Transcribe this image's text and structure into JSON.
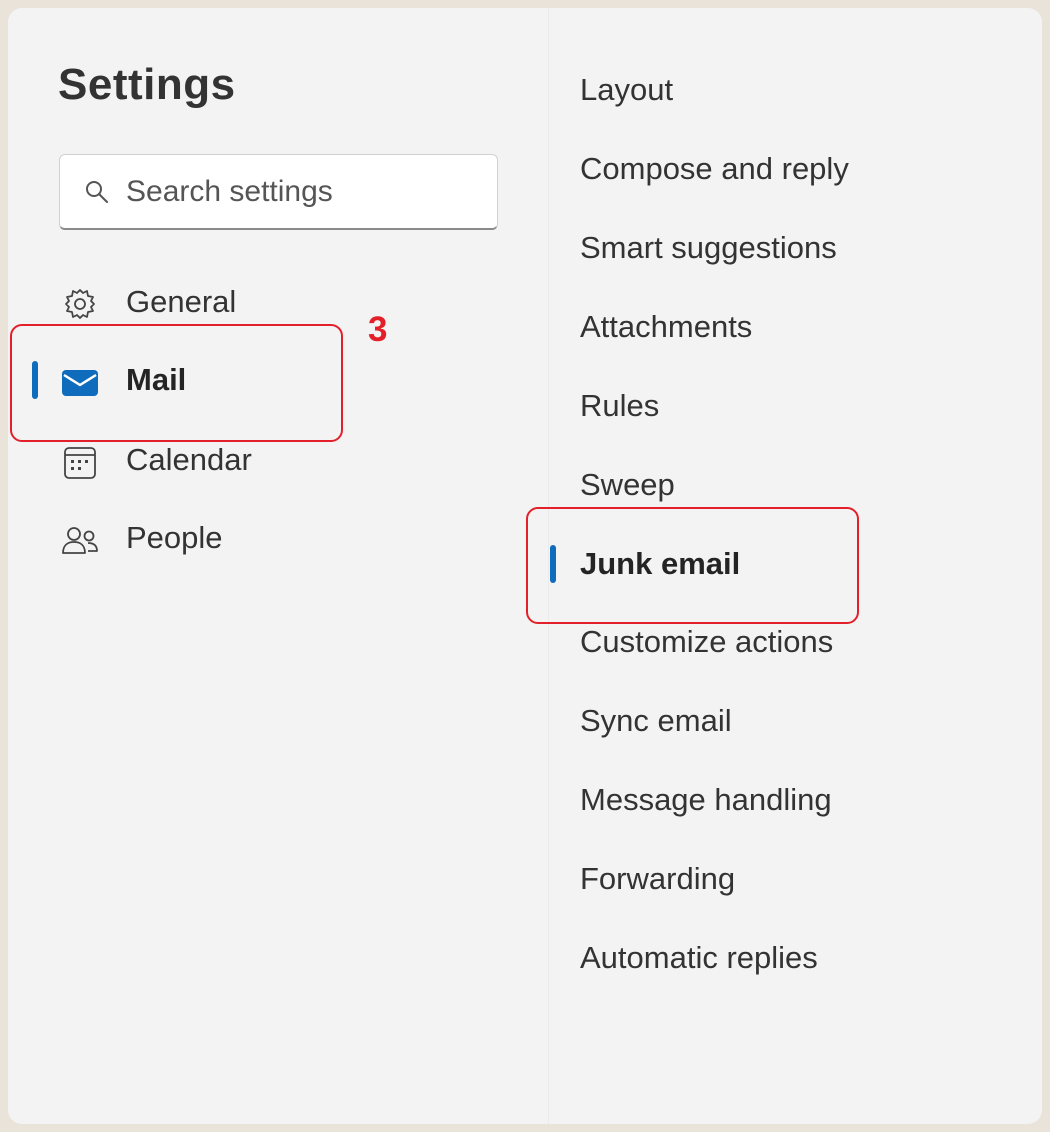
{
  "settings": {
    "title": "Settings",
    "search": {
      "placeholder": "Search settings",
      "icon": "search-icon"
    },
    "nav": [
      {
        "label": "General",
        "icon": "gear-icon",
        "selected": false
      },
      {
        "label": "Mail",
        "icon": "mail-icon",
        "selected": true
      },
      {
        "label": "Calendar",
        "icon": "calendar-icon",
        "selected": false
      },
      {
        "label": "People",
        "icon": "people-icon",
        "selected": false
      }
    ],
    "mail_subsections": [
      {
        "label": "Layout",
        "selected": false
      },
      {
        "label": "Compose and reply",
        "selected": false
      },
      {
        "label": "Smart suggestions",
        "selected": false
      },
      {
        "label": "Attachments",
        "selected": false
      },
      {
        "label": "Rules",
        "selected": false
      },
      {
        "label": "Sweep",
        "selected": false
      },
      {
        "label": "Junk email",
        "selected": true
      },
      {
        "label": "Customize actions",
        "selected": false
      },
      {
        "label": "Sync email",
        "selected": false
      },
      {
        "label": "Message handling",
        "selected": false
      },
      {
        "label": "Forwarding",
        "selected": false
      },
      {
        "label": "Automatic replies",
        "selected": false
      }
    ]
  },
  "annotation": {
    "step_label": "3",
    "color": "#e3202a"
  },
  "colors": {
    "accent": "#0f6cbd",
    "background": "#f3f3f3",
    "outer": "#eae3da"
  }
}
